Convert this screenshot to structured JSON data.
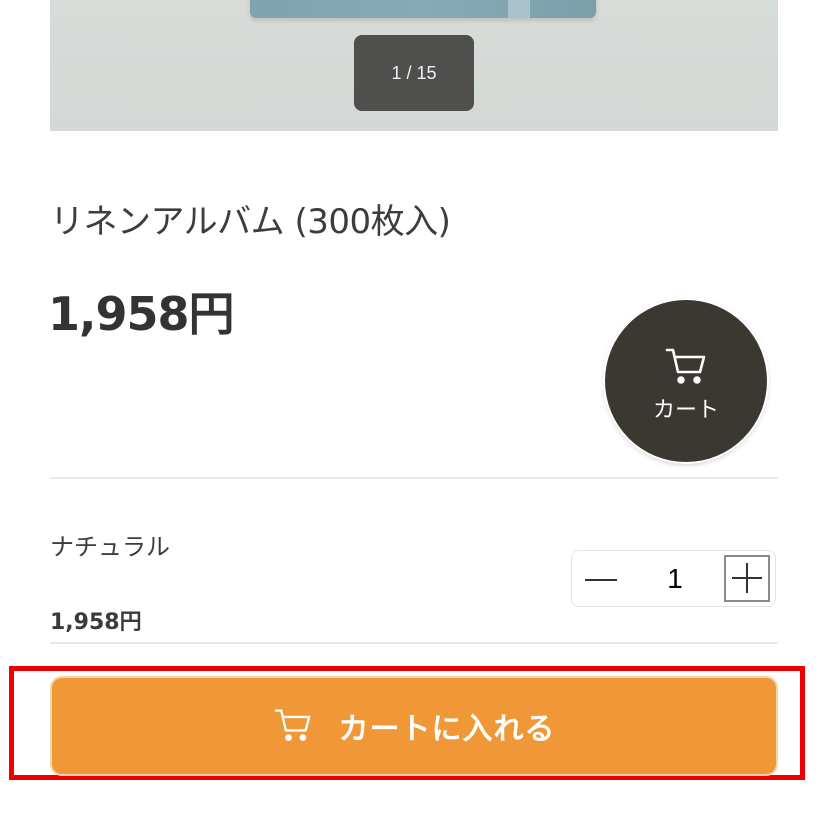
{
  "gallery": {
    "counter": "1 / 15"
  },
  "product": {
    "title": "リネンアルバム (300枚入)",
    "price": "1,958円"
  },
  "floating_cart": {
    "icon": "cart-icon",
    "label": "カート"
  },
  "variant": {
    "name": "ナチュラル",
    "price": "1,958円"
  },
  "quantity": {
    "value": "1",
    "decrement_icon": "minus-icon",
    "increment_icon": "plus-icon"
  },
  "add_to_cart": {
    "icon": "cart-icon",
    "label": "カートに入れる"
  },
  "colors": {
    "accent": "#f09838",
    "floating_cart_bg": "#3a3831",
    "highlight": "#ee0000"
  }
}
